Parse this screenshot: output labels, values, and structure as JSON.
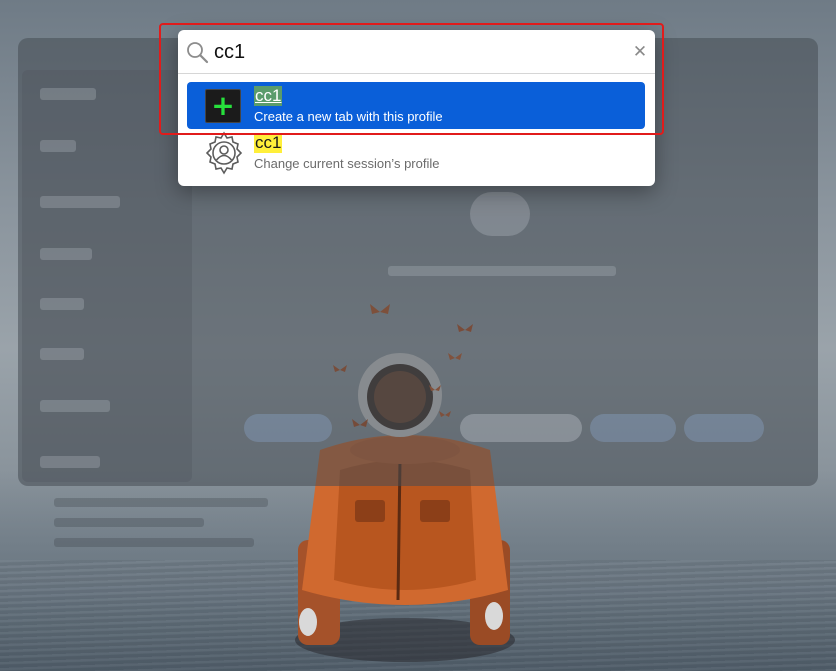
{
  "search": {
    "query": "cc1",
    "placeholder": ""
  },
  "results": [
    {
      "title": "cc1",
      "subtitle": "Create a new tab with this profile",
      "icon": "plus-icon",
      "selected": true
    },
    {
      "title": "cc1",
      "subtitle": "Change current session’s profile",
      "icon": "gear-icon",
      "selected": false
    }
  ],
  "colors": {
    "selection": "#0a5fd9",
    "match_highlight": "#ffef3a",
    "plus_green": "#27e03c",
    "annotation_red": "#e11b1b"
  },
  "icons": {
    "search": "search-icon",
    "clear": "close-icon",
    "new_tab": "plus-icon",
    "profile": "gear-icon"
  }
}
